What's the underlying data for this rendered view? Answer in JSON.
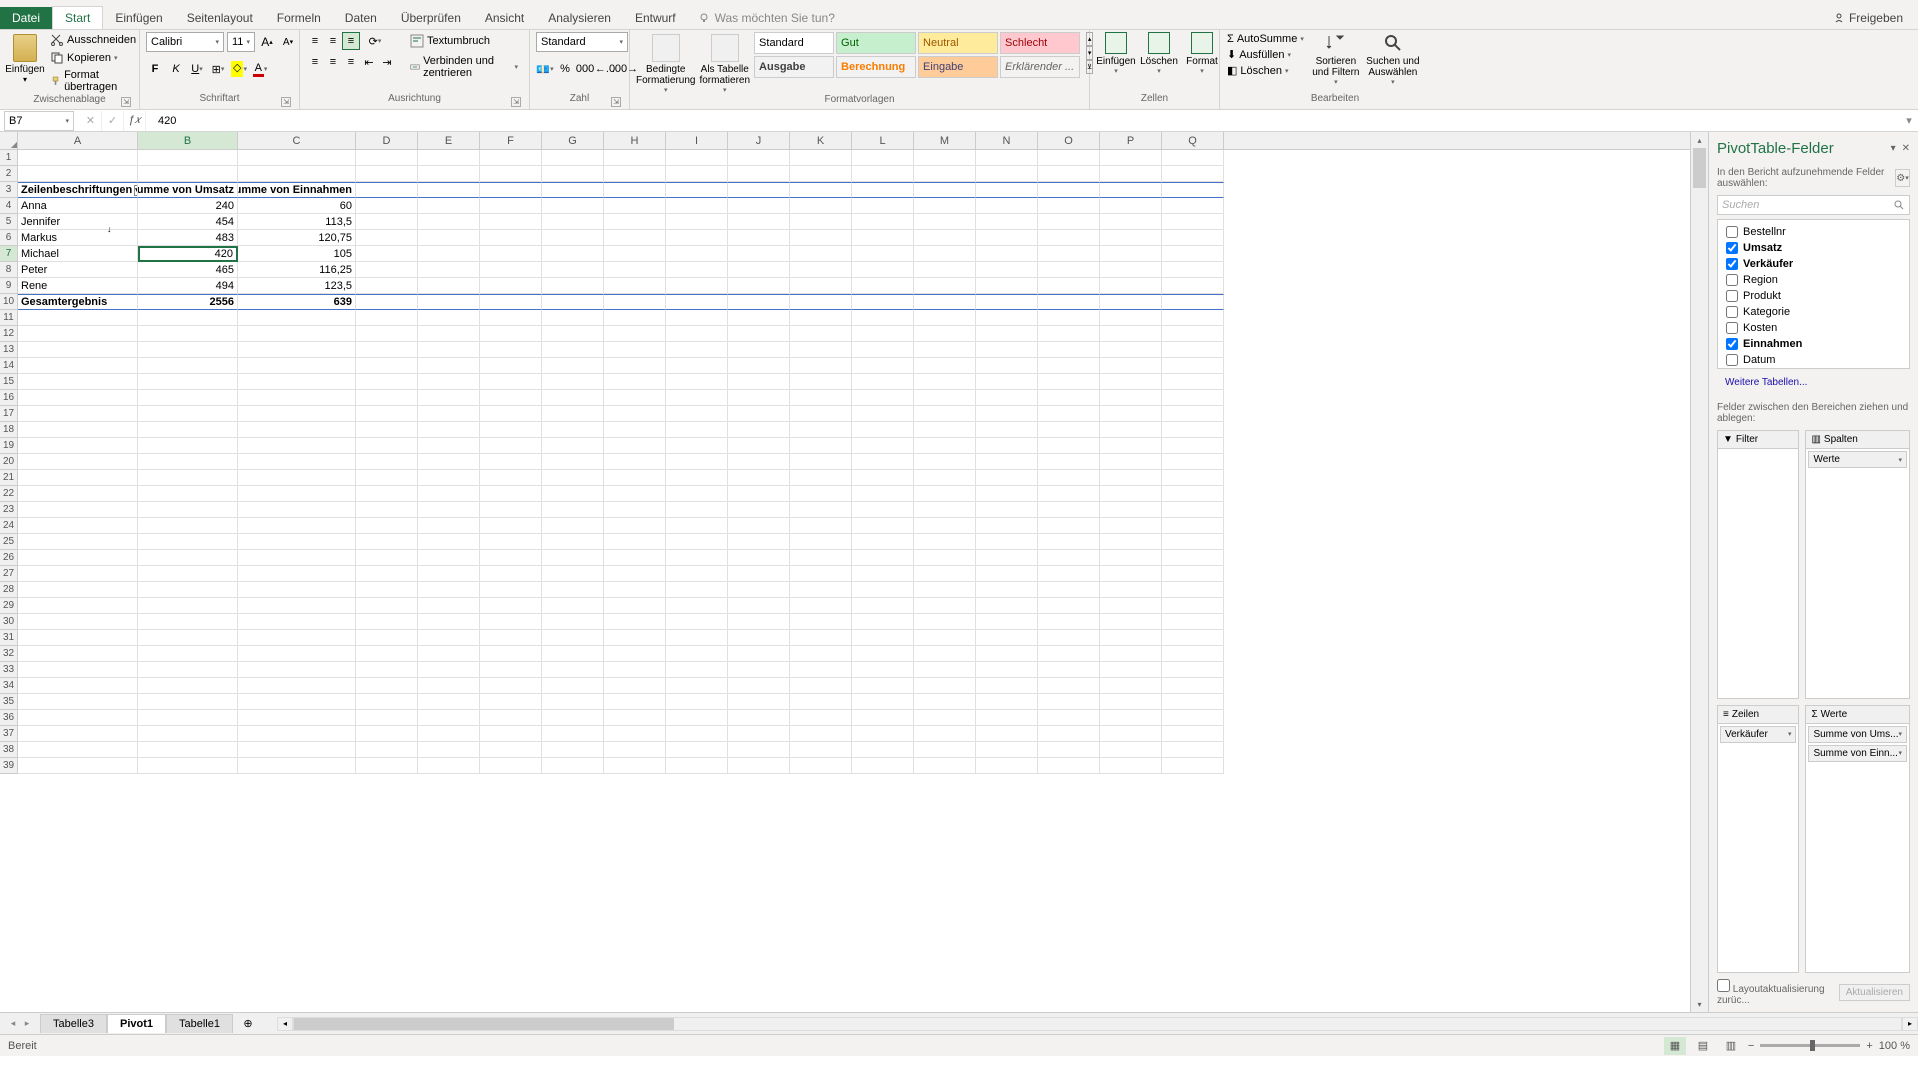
{
  "tabs": {
    "file": "Datei",
    "start": "Start",
    "einfugen": "Einfügen",
    "seitenlayout": "Seitenlayout",
    "formeln": "Formeln",
    "daten": "Daten",
    "uberprufen": "Überprüfen",
    "ansicht": "Ansicht",
    "analysieren": "Analysieren",
    "entwurf": "Entwurf",
    "tellme": "Was möchten Sie tun?",
    "share": "Freigeben"
  },
  "ribbon": {
    "clipboard": {
      "paste": "Einfügen",
      "cut": "Ausschneiden",
      "copy": "Kopieren",
      "format_painter": "Format übertragen",
      "label": "Zwischenablage"
    },
    "font": {
      "name": "Calibri",
      "size": "11",
      "label": "Schriftart"
    },
    "alignment": {
      "wrap": "Textumbruch",
      "merge": "Verbinden und zentrieren",
      "label": "Ausrichtung"
    },
    "number": {
      "format": "Standard",
      "label": "Zahl"
    },
    "styles": {
      "conditional": "Bedingte Formatierung",
      "as_table": "Als Tabelle formatieren",
      "standard": "Standard",
      "gut": "Gut",
      "neutral": "Neutral",
      "schlecht": "Schlecht",
      "ausgabe": "Ausgabe",
      "berechnung": "Berechnung",
      "eingabe": "Eingabe",
      "erklarend": "Erklärender ...",
      "label": "Formatvorlagen"
    },
    "cells": {
      "insert": "Einfügen",
      "delete": "Löschen",
      "format": "Format",
      "label": "Zellen"
    },
    "editing": {
      "autosum": "AutoSumme",
      "fill": "Ausfüllen",
      "clear": "Löschen",
      "sort": "Sortieren und Filtern",
      "find": "Suchen und Auswählen",
      "label": "Bearbeiten"
    }
  },
  "formula_bar": {
    "name_box": "B7",
    "formula": "420"
  },
  "columns": [
    "A",
    "B",
    "C",
    "D",
    "E",
    "F",
    "G",
    "H",
    "I",
    "J",
    "K",
    "L",
    "M",
    "N",
    "O",
    "P",
    "Q"
  ],
  "pivot": {
    "headers": {
      "rows": "Zeilenbeschriftungen",
      "sum_umsatz": "Summe von Umsatz",
      "sum_einnahmen": "Summe von Einnahmen"
    },
    "data": [
      {
        "name": "Anna",
        "umsatz": "240",
        "einnahmen": "60"
      },
      {
        "name": "Jennifer",
        "umsatz": "454",
        "einnahmen": "113,5"
      },
      {
        "name": "Markus",
        "umsatz": "483",
        "einnahmen": "120,75"
      },
      {
        "name": "Michael",
        "umsatz": "420",
        "einnahmen": "105"
      },
      {
        "name": "Peter",
        "umsatz": "465",
        "einnahmen": "116,25"
      },
      {
        "name": "Rene",
        "umsatz": "494",
        "einnahmen": "123,5"
      }
    ],
    "total": {
      "label": "Gesamtergebnis",
      "umsatz": "2556",
      "einnahmen": "639"
    }
  },
  "pivot_panel": {
    "title": "PivotTable-Felder",
    "instr": "In den Bericht aufzunehmende Felder auswählen:",
    "search": "Suchen",
    "fields": [
      {
        "name": "Bestellnr",
        "checked": false
      },
      {
        "name": "Umsatz",
        "checked": true
      },
      {
        "name": "Verkäufer",
        "checked": true
      },
      {
        "name": "Region",
        "checked": false
      },
      {
        "name": "Produkt",
        "checked": false
      },
      {
        "name": "Kategorie",
        "checked": false
      },
      {
        "name": "Kosten",
        "checked": false
      },
      {
        "name": "Einnahmen",
        "checked": true
      },
      {
        "name": "Datum",
        "checked": false
      }
    ],
    "more_tables": "Weitere Tabellen...",
    "drop_instr": "Felder zwischen den Bereichen ziehen und ablegen:",
    "areas": {
      "filter": "Filter",
      "columns": "Spalten",
      "rows": "Zeilen",
      "values": "Werte"
    },
    "area_items": {
      "columns": [
        "Werte"
      ],
      "rows": [
        "Verkäufer"
      ],
      "values": [
        "Summe von Ums...",
        "Summe von Einn..."
      ]
    },
    "defer": "Layoutaktualisierung zurüc...",
    "update": "Aktualisieren"
  },
  "sheets": {
    "tab1": "Tabelle3",
    "tab2": "Pivot1",
    "tab3": "Tabelle1"
  },
  "status": {
    "ready": "Bereit",
    "zoom": "100 %"
  }
}
